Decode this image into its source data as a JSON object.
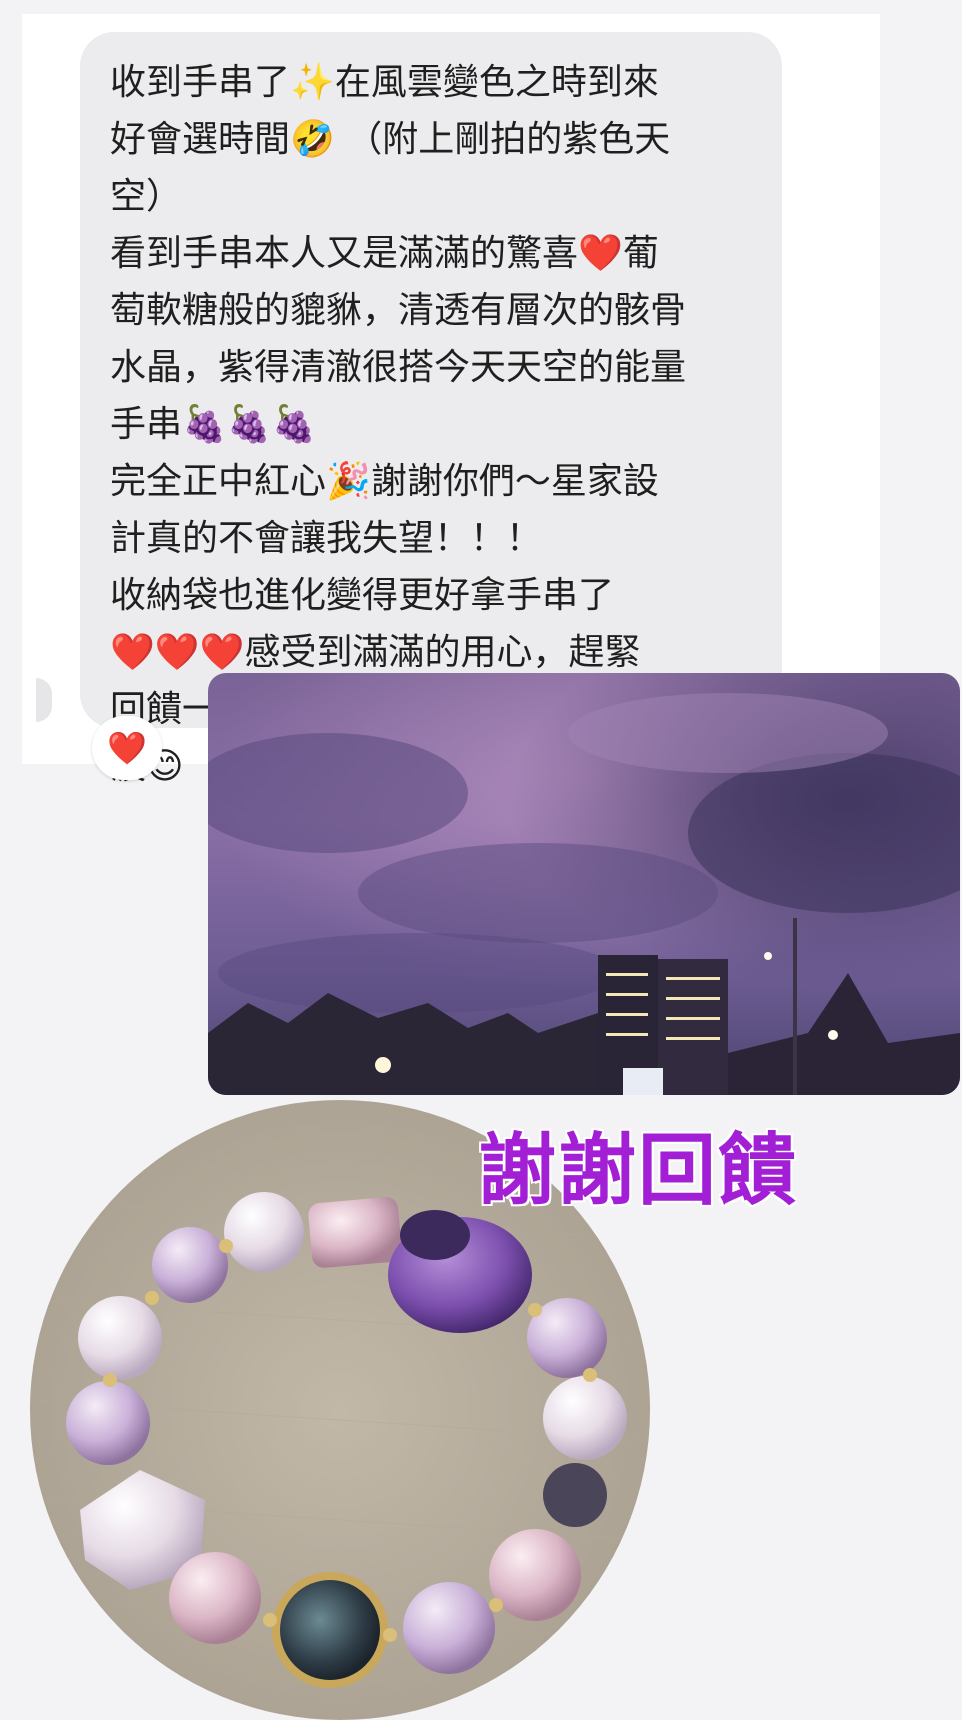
{
  "message": {
    "lines": [
      "收到手串了✨在風雲變色之時到來",
      "好會選時間🤣 （附上剛拍的紫色天",
      "空）",
      "看到手串本人又是滿滿的驚喜❤️葡",
      "萄軟糖般的貔貅，清透有層次的骸骨",
      "水晶，紫得清澈很搭今天天空的能量",
      "手串🍇🍇🍇",
      "完全正中紅心🎉謝謝你們～星家設",
      "計真的不會讓我失望！！！",
      "收納袋也進化變得更好拿手串了",
      "❤️❤️❤️感受到滿滿的用心，趕緊",
      "回饋一波💪等有太陽了再好好拍一",
      "波😊"
    ],
    "reaction": "❤️"
  },
  "caption": "謝謝回饋",
  "colors": {
    "bubble": "#ececee",
    "caption": "#a21fd6",
    "reaction": "#e0142b"
  }
}
